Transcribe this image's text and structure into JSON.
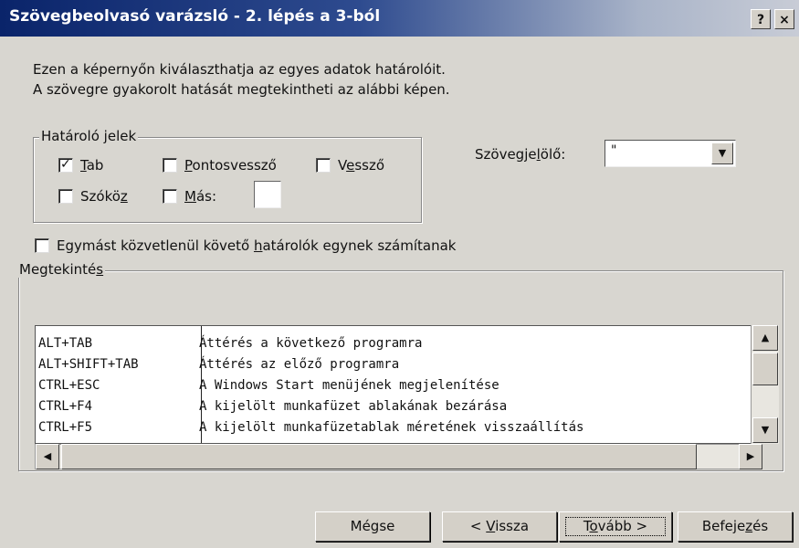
{
  "window": {
    "title": "Szövegbeolvasó varázsló - 2. lépés a 3-ból",
    "help_label": "?",
    "close_label": "×"
  },
  "intro": {
    "line1": "Ezen a képernyőn kiválaszthatja az egyes adatok határolóit.",
    "line2": "A szövegre gyakorolt hatását megtekintheti az alábbi képen."
  },
  "delimiters": {
    "group_label": "Határoló jelek",
    "tab": {
      "label_underlined": "T",
      "label_rest": "ab",
      "checked": true
    },
    "semicolon": {
      "label_underlined": "P",
      "label_rest": "ontosvessző",
      "checked": false
    },
    "comma": {
      "label_pre": "V",
      "label_underlined": "e",
      "label_rest": "ssző",
      "checked": false
    },
    "space": {
      "label_pre": "Szókö",
      "label_underlined": "z",
      "label_rest": "",
      "checked": false
    },
    "other": {
      "label_underlined": "M",
      "label_rest": "ás:",
      "checked": false,
      "value": ""
    }
  },
  "text_qualifier": {
    "label_pre": "Szövegje",
    "label_underlined": "l",
    "label_rest": "ölő:",
    "value": "\""
  },
  "consecutive": {
    "label_pre": "Egymást közvetlenül követő ",
    "label_underlined": "h",
    "label_rest": "atárolók egynek számítanak",
    "checked": false
  },
  "preview": {
    "group_label_pre": "Megtekinté",
    "group_label_underlined": "s",
    "rows": [
      {
        "key": "ALT+TAB",
        "desc": "Áttérés a következő programra"
      },
      {
        "key": "ALT+SHIFT+TAB",
        "desc": "Áttérés az előző programra"
      },
      {
        "key": "CTRL+ESC",
        "desc": "A Windows Start menüjének megjelenítése"
      },
      {
        "key": "CTRL+F4",
        "desc": "A kijelölt munkafüzet ablakának bezárása"
      },
      {
        "key": "CTRL+F5",
        "desc": "A kijelölt munkafüzetablak méretének visszaállítás"
      }
    ]
  },
  "buttons": {
    "cancel": "Mégse",
    "back_pre": "< ",
    "back_underlined": "V",
    "back_rest": "issza",
    "next_pre": "T",
    "next_underlined": "o",
    "next_rest": "vább >",
    "finish_pre": "Befeje",
    "finish_underlined": "z",
    "finish_rest": "és"
  },
  "icons": {
    "checkmark": "checkmark-icon",
    "dropdown": "chevron-down-icon",
    "scroll_up": "arrow-up-icon",
    "scroll_down": "arrow-down-icon",
    "scroll_left": "arrow-left-icon",
    "scroll_right": "arrow-right-icon"
  }
}
